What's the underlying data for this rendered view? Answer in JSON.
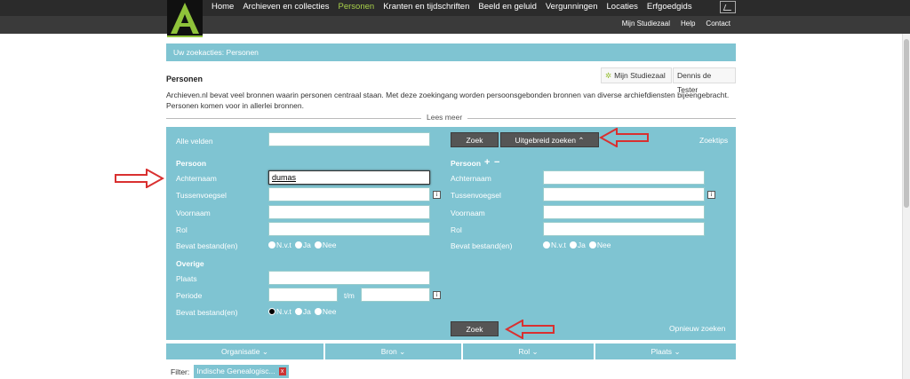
{
  "nav": {
    "items": [
      "Home",
      "Archieven en collecties",
      "Personen",
      "Kranten en tijdschriften",
      "Beeld en geluid",
      "Vergunningen",
      "Locaties",
      "Erfgoedgids"
    ],
    "active_index": 2,
    "sub": [
      "Mijn Studiezaal",
      "Help",
      "Contact"
    ]
  },
  "breadcrumb": "Uw zoekacties: Personen",
  "page": {
    "title": "Personen",
    "studiezaal_button": "Mijn Studiezaal",
    "user_button": "Dennis de Tester",
    "intro": "Archieven.nl bevat veel bronnen waarin personen centraal staan. Met deze zoekingang worden persoonsgebonden bronnen van diverse archiefdiensten bijeengebracht. Personen komen voor in allerlei bronnen.",
    "lees_meer": "Lees meer"
  },
  "search": {
    "alle_velden_label": "Alle velden",
    "zoek_label": "Zoek",
    "uitgebreid_label": "Uitgebreid zoeken",
    "zoektips_label": "Zoektips",
    "person1": {
      "heading": "Persoon",
      "achternaam_label": "Achternaam",
      "achternaam_value": "dumas",
      "tussenvoegsel_label": "Tussenvoegsel",
      "voornaam_label": "Voornaam",
      "rol_label": "Rol",
      "bestand_label": "Bevat bestand(en)"
    },
    "person2": {
      "heading": "Persoon",
      "plus": "+",
      "minus": "−",
      "achternaam_label": "Achternaam",
      "tussenvoegsel_label": "Tussenvoegsel",
      "voornaam_label": "Voornaam",
      "rol_label": "Rol",
      "bestand_label": "Bevat bestand(en)"
    },
    "overige": {
      "heading": "Overige",
      "plaats_label": "Plaats",
      "periode_label": "Periode",
      "tm_label": "t/m",
      "bestand_label": "Bevat bestand(en)"
    },
    "radio_options": [
      "N.v.t",
      "Ja",
      "Nee"
    ],
    "opnieuw_label": "Opnieuw zoeken"
  },
  "facets": [
    "Organisatie",
    "Bron",
    "Rol",
    "Plaats"
  ],
  "filter": {
    "label": "Filter:",
    "chip": "Indische Genealogisc...",
    "remove": "x"
  },
  "colors": {
    "panel": "#7fc4d2",
    "nav_active": "#a8d04a",
    "annotation": "#d93030"
  }
}
